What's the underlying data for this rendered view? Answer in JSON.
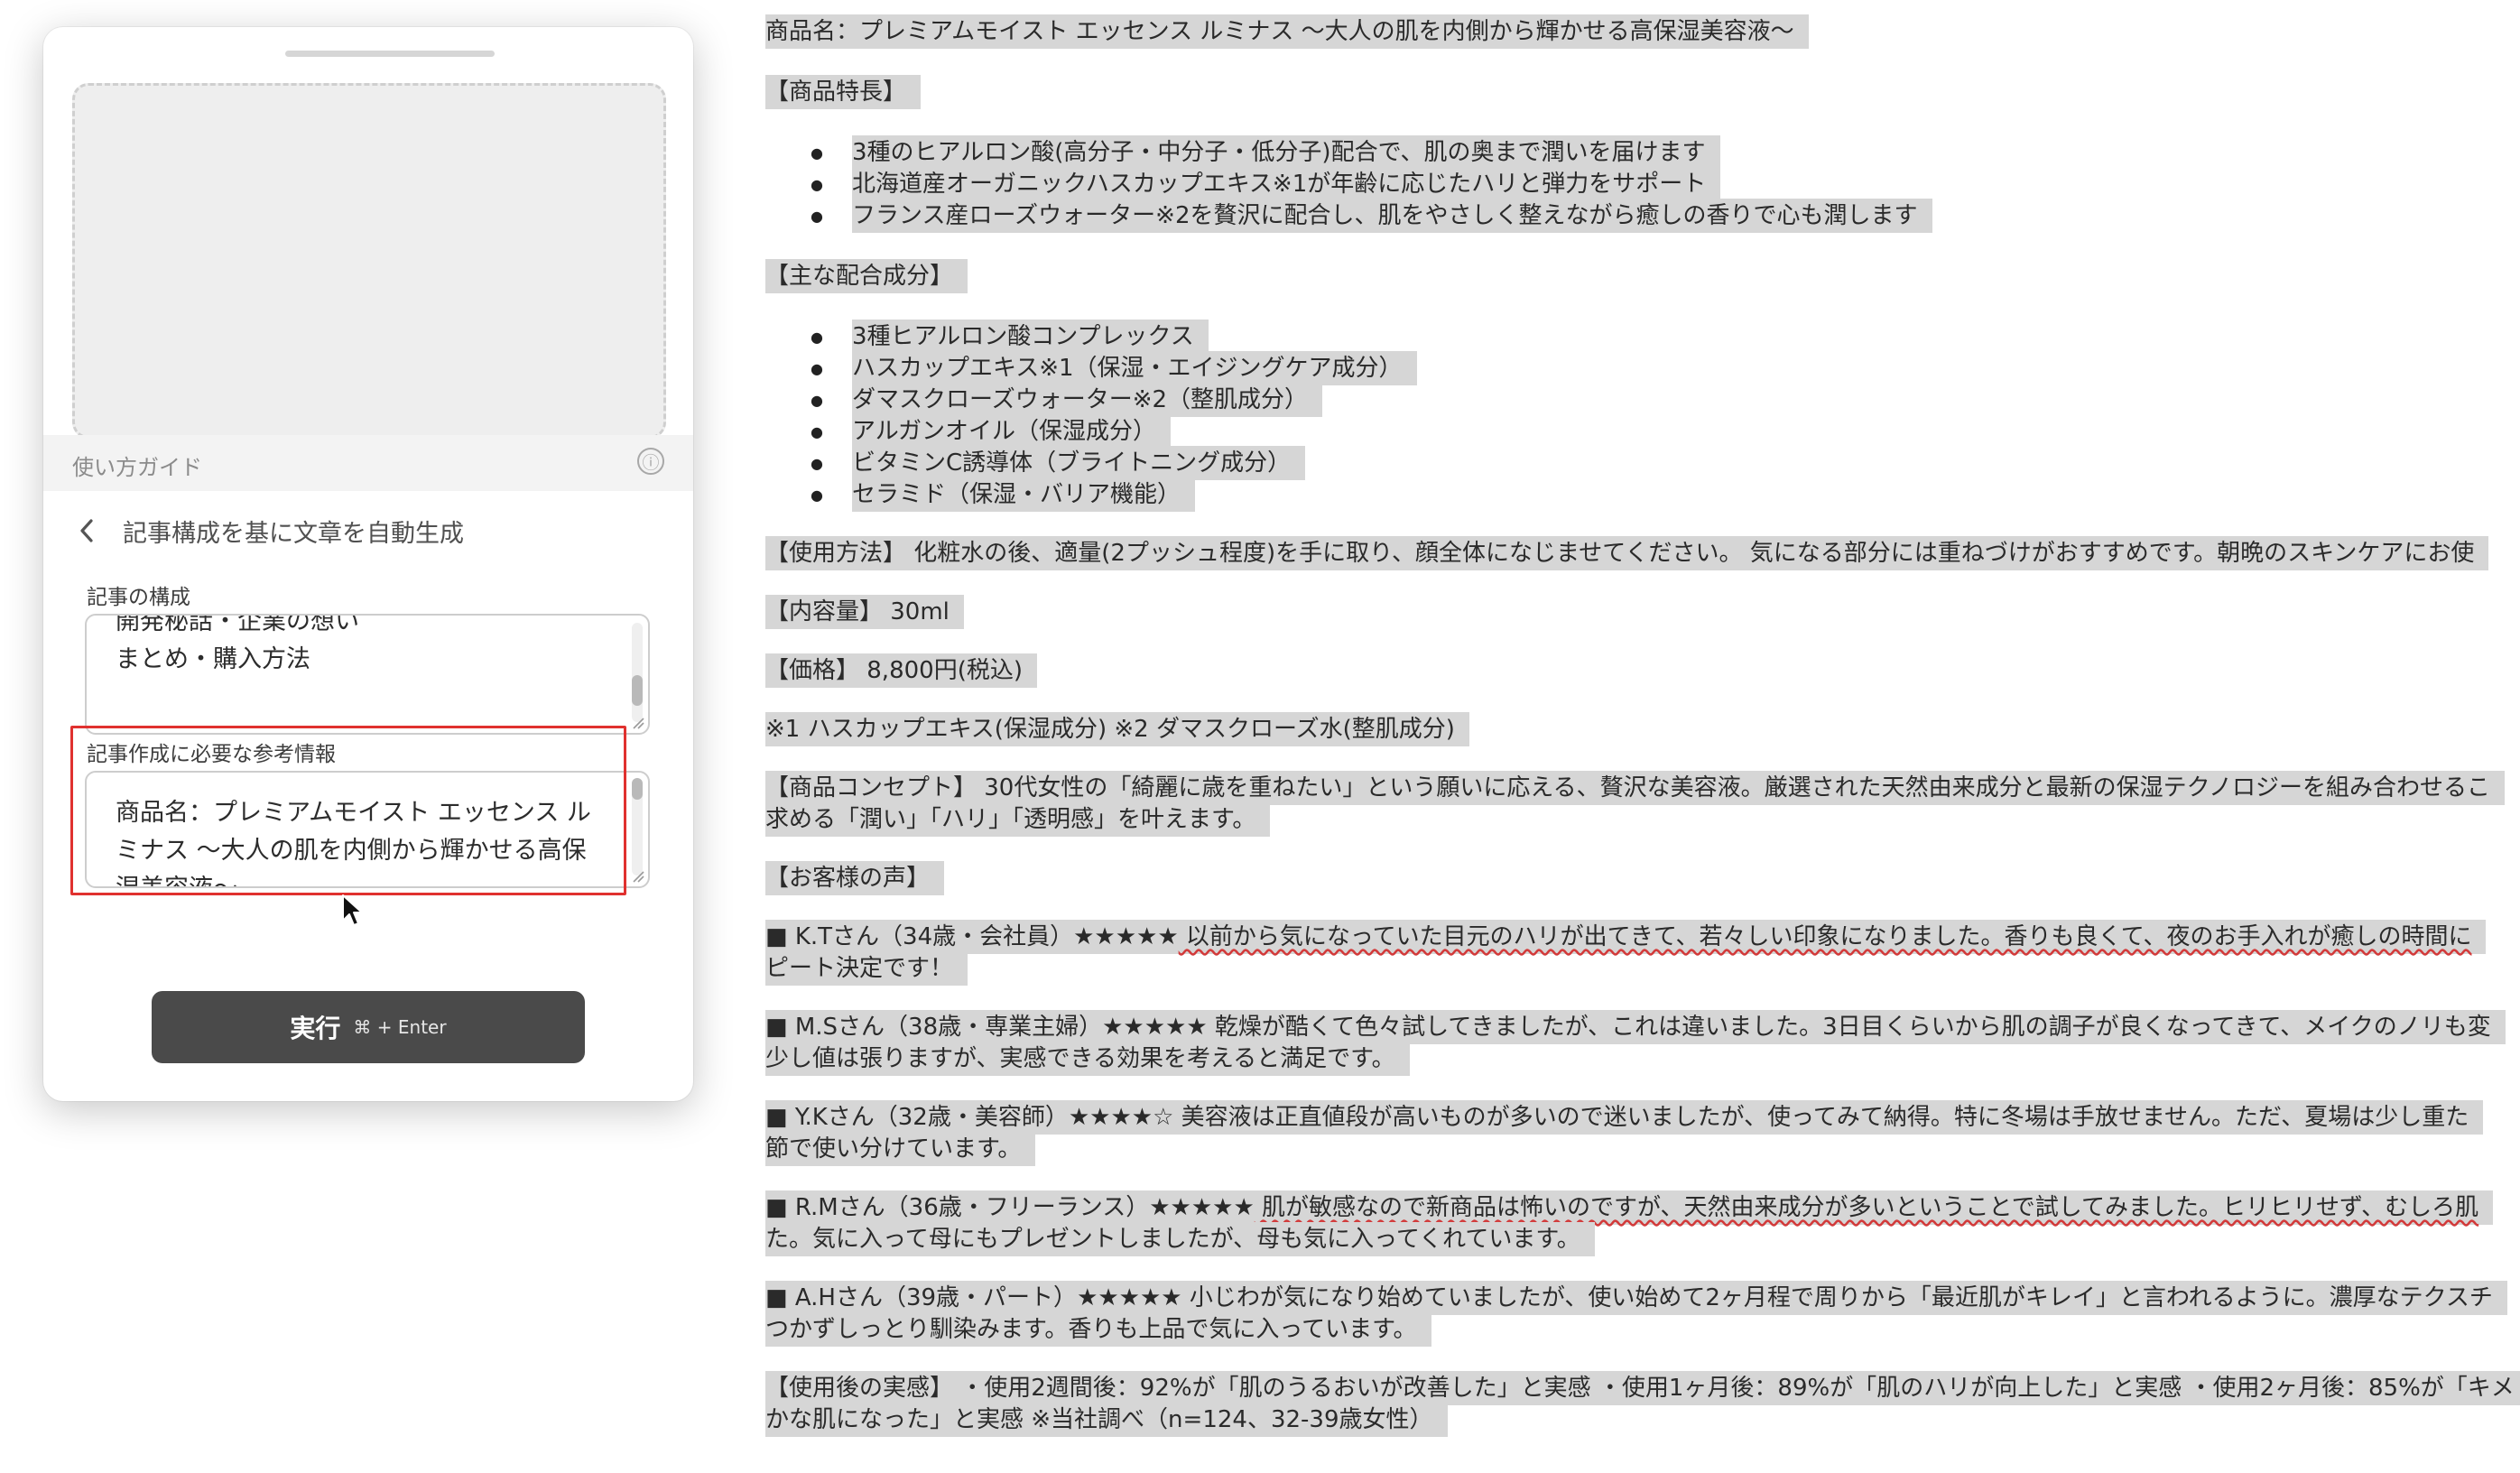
{
  "panel": {
    "guide_label": "使い方ガイド",
    "info_icon": "ⓘ",
    "back_title": "記事構成を基に文章を自動生成",
    "structure_label": "記事の構成",
    "structure_text": "開発秘話・企業の想い\nまとめ・購入方法",
    "reference_label": "記事作成に必要な参考情報",
    "reference_text": "商品名：プレミアムモイスト エッセンス ルミナス 〜大人の肌を内側から輝かせる高保湿美容液〜",
    "run_label": "実行",
    "run_shortcut": "⌘ + Enter"
  },
  "doc": {
    "title": "商品名：プレミアムモイスト エッセンス ルミナス 〜大人の肌を内側から輝かせる高保湿美容液〜",
    "features_heading": "【商品特長】",
    "features": [
      "3種のヒアルロン酸(高分子・中分子・低分子)配合で、肌の奥まで潤いを届けます",
      "北海道産オーガニックハスカップエキス※1が年齢に応じたハリと弾力をサポート",
      "フランス産ローズウォーター※2を贅沢に配合し、肌をやさしく整えながら癒しの香りで心も潤します"
    ],
    "ingredients_heading": "【主な配合成分】",
    "ingredients": [
      "3種ヒアルロン酸コンプレックス",
      "ハスカップエキス※1（保湿・エイジングケア成分）",
      "ダマスクローズウォーター※2（整肌成分）",
      "アルガンオイル（保湿成分）",
      "ビタミンC誘導体（ブライトニング成分）",
      "セラミド（保湿・バリア機能）"
    ],
    "usage": "【使用方法】 化粧水の後、適量(2プッシュ程度)を手に取り、顔全体になじませてください。 気になる部分には重ねづけがおすすめです。朝晩のスキンケアにお使",
    "volume": "【内容量】 30ml",
    "price": "【価格】 8,800円(税込)",
    "notes": "※1 ハスカップエキス(保湿成分) ※2 ダマスクローズ水(整肌成分)",
    "concept_1": "【商品コンセプト】 30代女性の「綺麗に歳を重ねたい」という願いに応える、贅沢な美容液。厳選された天然由来成分と最新の保湿テクノロジーを組み合わせるこ",
    "concept_2": "求める「潤い」「ハリ」「透明感」を叶えます。",
    "voices_heading": "【お客様の声】",
    "voices": [
      {
        "pre": "■ K.Tさん（34歳・会社員）",
        "stars": "★★★★★",
        "rest": " 以前から気になっていた目元のハリが出てきて、若々しい印象になりました。香りも良くて、夜のお手入れが癒しの時間に",
        "line2": "ピート決定です！",
        "wavy": true
      },
      {
        "pre": "■ M.Sさん（38歳・専業主婦）",
        "stars": "★★★★★",
        "rest": " 乾燥が酷くて色々試してきましたが、これは違いました。3日目くらいから肌の調子が良くなってきて、メイクのノリも変",
        "line2": "少し値は張りますが、実感できる効果を考えると満足です。",
        "wavy": false
      },
      {
        "pre": "■ Y.Kさん（32歳・美容師）",
        "stars": "★★★★☆",
        "rest": " 美容液は正直値段が高いものが多いので迷いましたが、使ってみて納得。特に冬場は手放せません。ただ、夏場は少し重た",
        "line2": "節で使い分けています。",
        "wavy": false
      },
      {
        "pre": "■ R.Mさん（36歳・フリーランス）",
        "stars": "★★★★★",
        "rest": " 肌が敏感なので新商品は怖いのですが、天然由来成分が多いということで試してみました。ヒリヒリせず、むしろ肌",
        "line2": "た。気に入って母にもプレゼントしましたが、母も気に入ってくれています。",
        "wavy": true
      },
      {
        "pre": "■ A.Hさん（39歳・パート）",
        "stars": "★★★★★",
        "rest": " 小じわが気になり始めていましたが、使い始めて2ヶ月程で周りから「最近肌がキレイ」と言われるように。濃厚なテクスチ",
        "line2": "つかずしっとり馴染みます。香りも上品で気に入っています。",
        "wavy": false
      }
    ],
    "after_1": "【使用後の実感】 ・使用2週間後：92%が「肌のうるおいが改善した」と実感 ・使用1ヶ月後：89%が「肌のハリが向上した」と実感 ・使用2ヶ月後：85%が「キメ",
    "after_2": "かな肌になった」と実感 ※当社調べ（n=124、32-39歳女性）"
  }
}
